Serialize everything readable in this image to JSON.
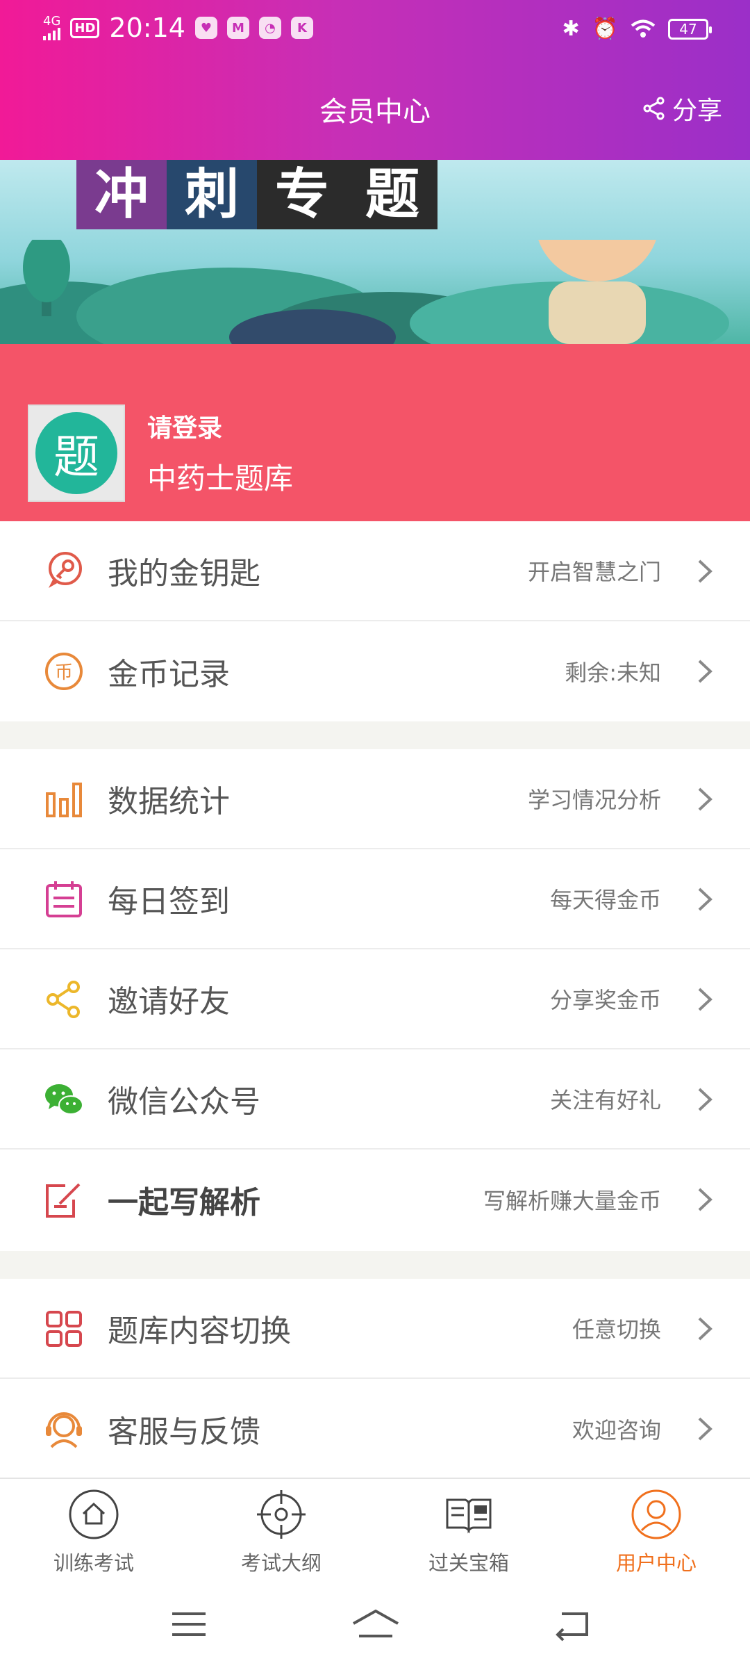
{
  "status_bar": {
    "network": "4G",
    "hd": "HD",
    "time": "20:14",
    "battery": "47",
    "app_icons": [
      "M",
      "K"
    ]
  },
  "header": {
    "title": "会员中心",
    "share_label": "分享",
    "gradient_colors": [
      "#f11a97",
      "#9b2fc8"
    ]
  },
  "banner": {
    "chars": [
      "冲",
      "刺",
      "专",
      "题"
    ]
  },
  "profile": {
    "login_label": "请登录",
    "bank_name": "中药士题库",
    "avatar_glyph": "题",
    "background": "#f45468"
  },
  "menu_group_1": [
    {
      "label": "我的金钥匙",
      "hint": "开启智慧之门",
      "icon": "key-icon"
    },
    {
      "label": "金币记录",
      "hint": "剩余:未知",
      "icon": "coin-icon"
    }
  ],
  "menu_group_2": [
    {
      "label": "数据统计",
      "hint": "学习情况分析",
      "icon": "bar-chart-icon"
    },
    {
      "label": "每日签到",
      "hint": "每天得金币",
      "icon": "calendar-icon"
    },
    {
      "label": "邀请好友",
      "hint": "分享奖金币",
      "icon": "share-icon"
    },
    {
      "label": "微信公众号",
      "hint": "关注有好礼",
      "icon": "wechat-icon"
    },
    {
      "label": "一起写解析",
      "hint": "写解析赚大量金币",
      "icon": "edit-icon"
    }
  ],
  "menu_group_3": [
    {
      "label": "题库内容切换",
      "hint": "任意切换",
      "icon": "grid-icon"
    },
    {
      "label": "客服与反馈",
      "hint": "欢迎咨询",
      "icon": "headset-icon"
    }
  ],
  "bottom_nav": [
    {
      "label": "训练考试",
      "icon": "home-icon",
      "active": false
    },
    {
      "label": "考试大纲",
      "icon": "target-icon",
      "active": false
    },
    {
      "label": "过关宝箱",
      "icon": "book-icon",
      "active": false
    },
    {
      "label": "用户中心",
      "icon": "user-icon",
      "active": true
    }
  ],
  "accent_color": "#f0701d"
}
